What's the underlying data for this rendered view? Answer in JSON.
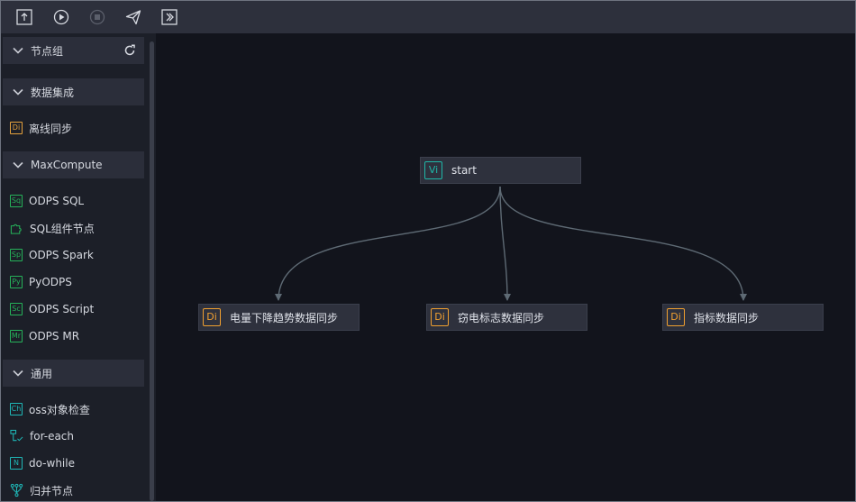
{
  "toolbar": {
    "buttons": [
      {
        "name": "submit-icon"
      },
      {
        "name": "run-icon"
      },
      {
        "name": "stop-icon"
      },
      {
        "name": "publish-icon"
      },
      {
        "name": "goto-ops-icon"
      }
    ]
  },
  "sidebar": {
    "groups": {
      "node_group": {
        "label": "节点组"
      },
      "data_integration": {
        "label": "数据集成",
        "items": [
          {
            "badge": "Di",
            "label": "离线同步"
          }
        ]
      },
      "maxcompute": {
        "label": "MaxCompute",
        "items": [
          {
            "badge": "Sq",
            "label": "ODPS SQL"
          },
          {
            "badge": "",
            "label": "SQL组件节点"
          },
          {
            "badge": "Sp",
            "label": "ODPS Spark"
          },
          {
            "badge": "Py",
            "label": "PyODPS"
          },
          {
            "badge": "Sc",
            "label": "ODPS Script"
          },
          {
            "badge": "Mr",
            "label": "ODPS MR"
          }
        ]
      },
      "general": {
        "label": "通用",
        "items": [
          {
            "badge": "Ch",
            "label": "oss对象检查"
          },
          {
            "badge": "",
            "label": "for-each"
          },
          {
            "badge": "N",
            "label": "do-while"
          },
          {
            "badge": "",
            "label": "归并节点"
          }
        ]
      }
    }
  },
  "canvas": {
    "nodes": [
      {
        "badge": "Vi",
        "label": "start"
      },
      {
        "badge": "Di",
        "label": "电量下降趋势数据同步"
      },
      {
        "badge": "Di",
        "label": "窃电标志数据同步"
      },
      {
        "badge": "Di",
        "label": "指标数据同步"
      }
    ]
  },
  "colors": {
    "toolbar_bg": "#2d303c",
    "sidebar_bg": "#1c1f28",
    "canvas_bg": "#12141c",
    "di_orange": "#f0a030",
    "odps_green": "#26b25a",
    "vi_teal": "#1fb8a8",
    "edge": "#5e6a74"
  }
}
